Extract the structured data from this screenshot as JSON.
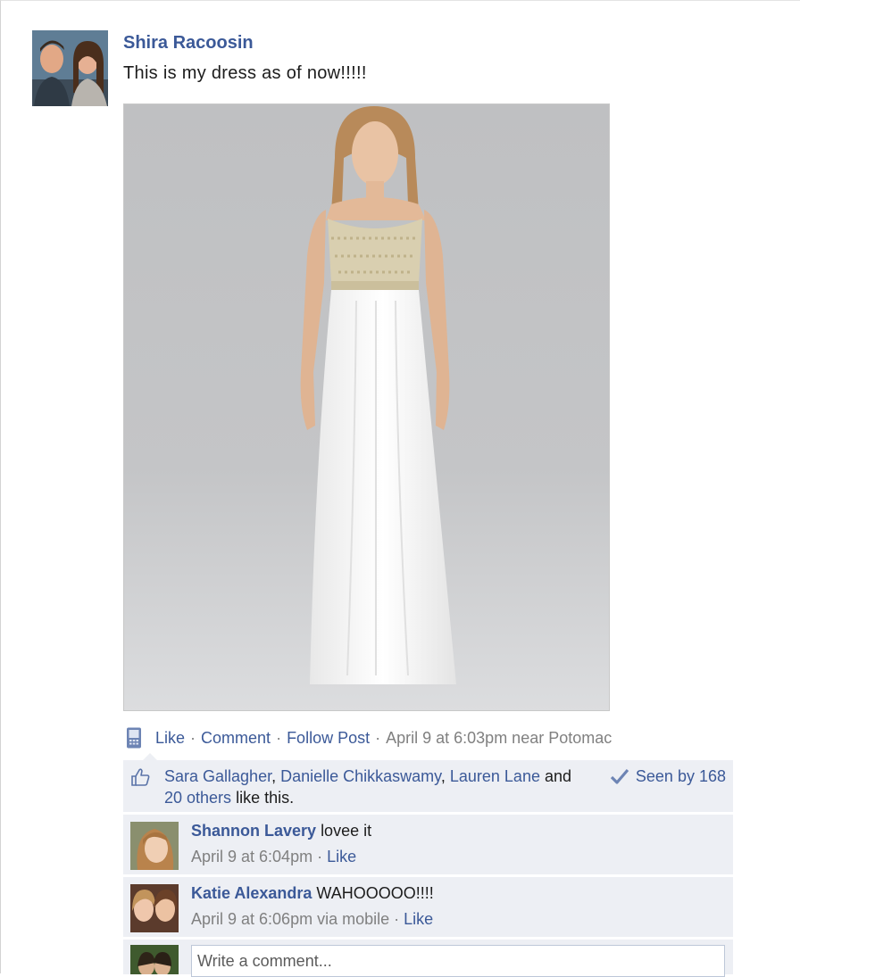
{
  "post": {
    "author": "Shira Racoosin",
    "message": "This is my dress as of now!!!!!",
    "actions": {
      "like": "Like",
      "separator": "·",
      "comment": "Comment",
      "follow": "Follow Post",
      "meta": "April 9 at 6:03pm near Potomac"
    }
  },
  "likes": {
    "name1": "Sara Gallagher",
    "comma1": ",",
    "name2": "Danielle Chikkaswamy",
    "comma2": ",",
    "name3": "Lauren Lane",
    "and": "and",
    "others": "20 others",
    "suffix": "like this.",
    "seen": "Seen by 168"
  },
  "comments": [
    {
      "name": "Shannon Lavery",
      "text": "lovee it",
      "time": "April 9 at 6:04pm",
      "sep": "·",
      "like": "Like"
    },
    {
      "name": "Katie Alexandra",
      "text": "WAHOOOOO!!!!",
      "time": "April 9 at 6:06pm via mobile",
      "sep": "·",
      "like": "Like"
    }
  ],
  "composer": {
    "placeholder": "Write a comment..."
  },
  "icons": {
    "mobile": "mobile-phone-icon",
    "thumb": "thumbs-up-icon",
    "check": "checkmark-icon"
  },
  "colors": {
    "link": "#3b5998",
    "panel": "#edeff4",
    "meta": "#808080"
  }
}
